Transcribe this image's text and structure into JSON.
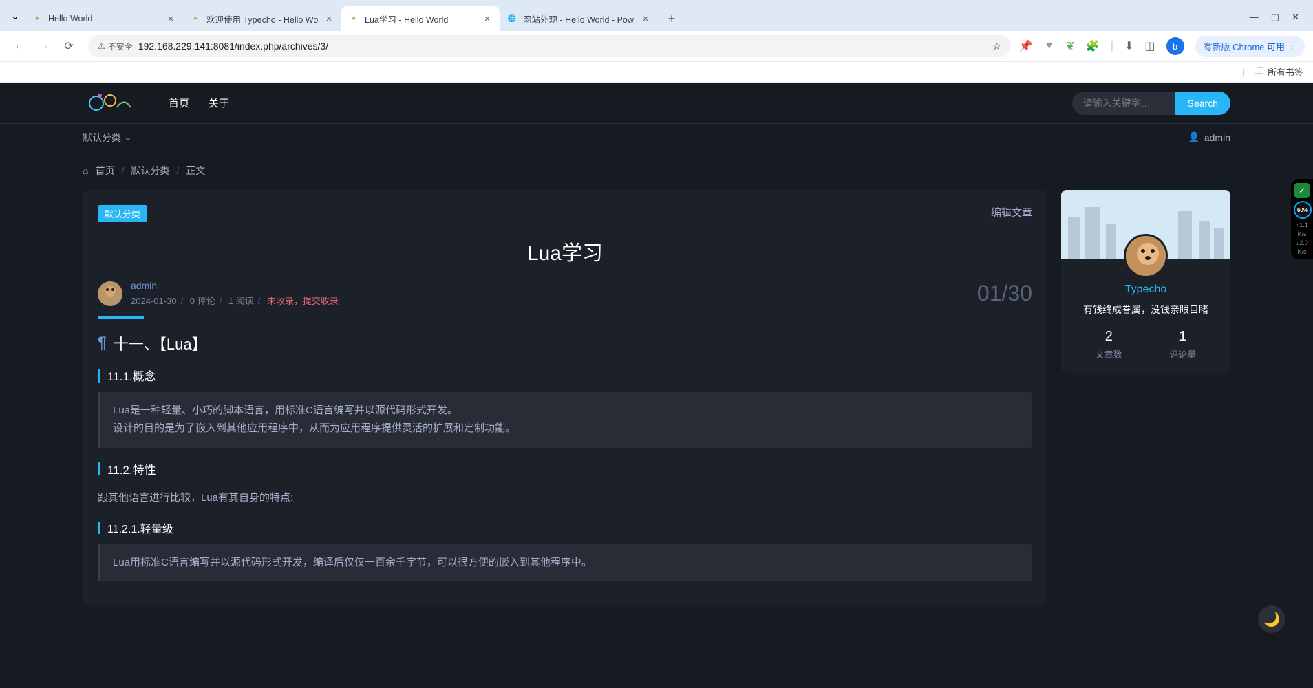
{
  "browser": {
    "tabs": [
      {
        "title": "Hello World",
        "favicon_fg": "#c95",
        "active": false
      },
      {
        "title": "欢迎使用 Typecho - Hello Wo",
        "favicon_fg": "#c95",
        "active": false
      },
      {
        "title": "Lua学习 - Hello World",
        "favicon_fg": "#c95",
        "active": true
      },
      {
        "title": "网站外观 - Hello World - Pow",
        "favicon_fg": "#888",
        "globe": true,
        "active": false
      }
    ],
    "insecure_label": "不安全",
    "url": "192.168.229.141:8081/index.php/archives/3/",
    "profile_letter": "b",
    "update_label": "有新版 Chrome 可用",
    "bookmarks_label": "所有书签"
  },
  "site": {
    "nav": {
      "home": "首页",
      "about": "关于"
    },
    "search": {
      "placeholder": "请输入关键字…",
      "button": "Search"
    },
    "subbar": {
      "category": "默认分类",
      "username": "admin"
    },
    "breadcrumb": {
      "home": "首页",
      "category": "默认分类",
      "current": "正文"
    },
    "post": {
      "tag": "默认分类",
      "edit": "编辑文章",
      "title": "Lua学习",
      "author": "admin",
      "date": "2024-01-30",
      "comments": "0 评论",
      "reads": "1 阅读",
      "baidu": "未收录，提交收录",
      "date_big": "01/30",
      "h1": "十一、【Lua】",
      "h2_1": "11.1.概念",
      "quote1": "Lua是一种轻量、小巧的脚本语言，用标准C语言编写并以源代码形式开发。\n设计的目的是为了嵌入到其他应用程序中，从而为应用程序提供灵活的扩展和定制功能。",
      "h2_2": "11.2.特性",
      "para1": "跟其他语言进行比较，Lua有其自身的特点:",
      "h3_1": "11.2.1.轻量级",
      "quote2": "Lua用标准C语言编写并以源代码形式开发，编译后仅仅一百余千字节，可以很方便的嵌入到其他程序中。"
    },
    "profile": {
      "name": "Typecho",
      "motto": "有钱终成眷属，没钱亲眼目睹",
      "posts_count": "2",
      "posts_label": "文章数",
      "comments_count": "1",
      "comments_label": "评论量"
    }
  },
  "monitor": {
    "gauge": "60%",
    "up": "1.1",
    "up_unit": "K/s",
    "down": "2.0",
    "down_unit": "K/s"
  }
}
